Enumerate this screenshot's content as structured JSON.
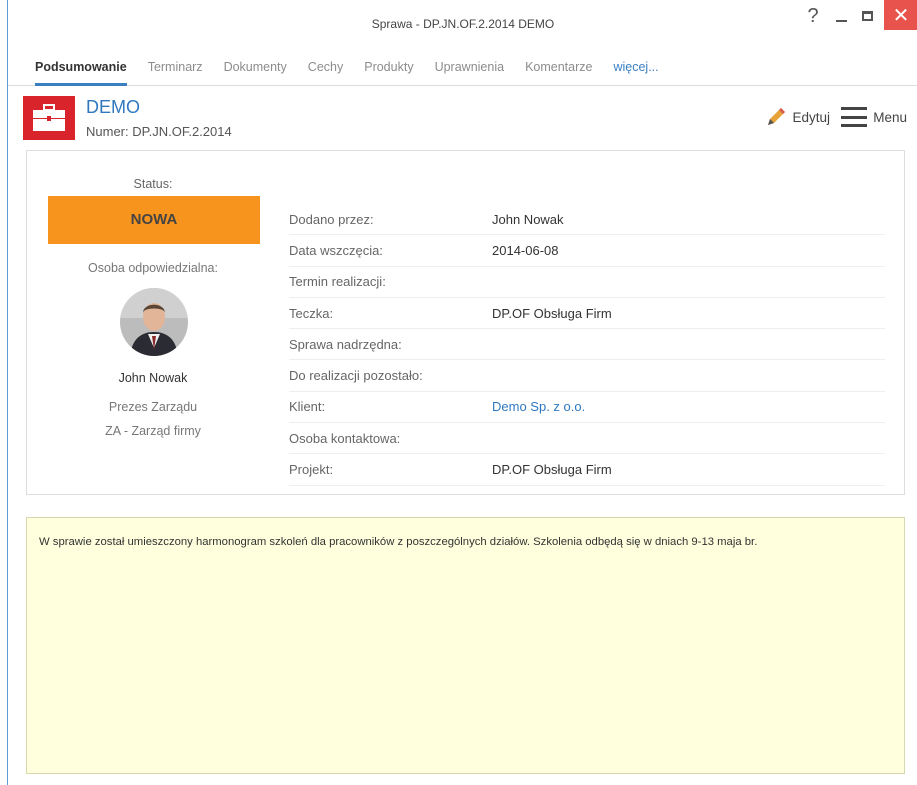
{
  "window": {
    "title": "Sprawa - DP.JN.OF.2.2014 DEMO",
    "help_glyph": "?",
    "close_glyph": "✕"
  },
  "tabs": [
    {
      "label": "Podsumowanie",
      "active": true
    },
    {
      "label": "Terminarz"
    },
    {
      "label": "Dokumenty"
    },
    {
      "label": "Cechy"
    },
    {
      "label": "Produkty"
    },
    {
      "label": "Uprawnienia"
    },
    {
      "label": "Komentarze"
    },
    {
      "label": "więcej..."
    }
  ],
  "header": {
    "title": "DEMO",
    "number": "Numer: DP.JN.OF.2.2014",
    "edit_label": "Edytuj",
    "menu_label": "Menu"
  },
  "summary": {
    "status_label": "Status:",
    "status_value": "NOWA",
    "responsible_label": "Osoba odpowiedzialna:",
    "person_name": "John Nowak",
    "person_role": "Prezes Zarządu",
    "person_dept": "ZA - Zarząd firmy"
  },
  "fields": [
    {
      "label": "Dodano przez:",
      "value": "John Nowak"
    },
    {
      "label": "Data wszczęcia:",
      "value": "2014-06-08"
    },
    {
      "label": "Termin realizacji:",
      "value": ""
    },
    {
      "label": "Teczka:",
      "value": "DP.OF Obsługa Firm"
    },
    {
      "label": "Sprawa nadrzędna:",
      "value": ""
    },
    {
      "label": "Do realizacji pozostało:",
      "value": ""
    },
    {
      "label": "Klient:",
      "value": "Demo Sp. z o.o."
    },
    {
      "label": "Osoba kontaktowa:",
      "value": ""
    },
    {
      "label": "Projekt:",
      "value": "DP.OF Obsługa Firm"
    }
  ],
  "note": {
    "text": "W sprawie został umieszczony harmonogram szkoleń dla pracowników z poszczególnych działów. Szkolenia odbędą się w dniach 9-13 maja br."
  },
  "colors": {
    "accent": "#3a7fc1",
    "status": "#f7941d",
    "case_icon_bg": "#d8242a",
    "close_button": "#e8544d",
    "note_bg": "#ffffdd"
  }
}
